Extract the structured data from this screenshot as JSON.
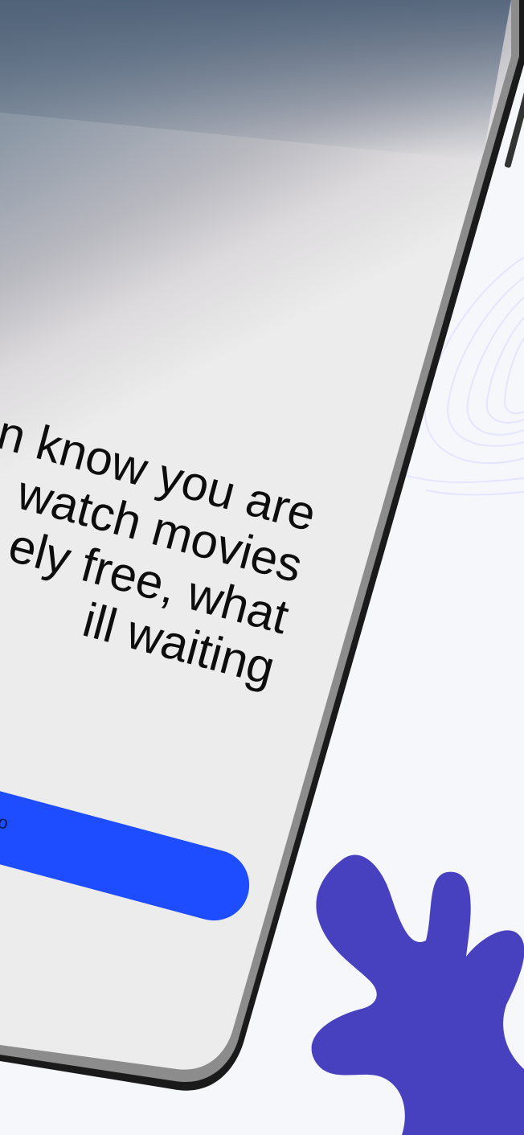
{
  "headline": {
    "lines": [
      "n know you are",
      "watch movies",
      "ely free, what",
      "ill waiting"
    ]
  },
  "cta": {
    "label": "ooo"
  },
  "colors": {
    "background": "#f6f7fb",
    "screen": "#ececec",
    "accent_button": "#1d4dff",
    "decor_blob": "#4740bf",
    "decor_lines": "#dfe2ff",
    "phone_frame": "#1a1a1a"
  },
  "icons": {
    "decor_blob": "organic-blob-shape",
    "decor_lines": "contour-lines"
  }
}
